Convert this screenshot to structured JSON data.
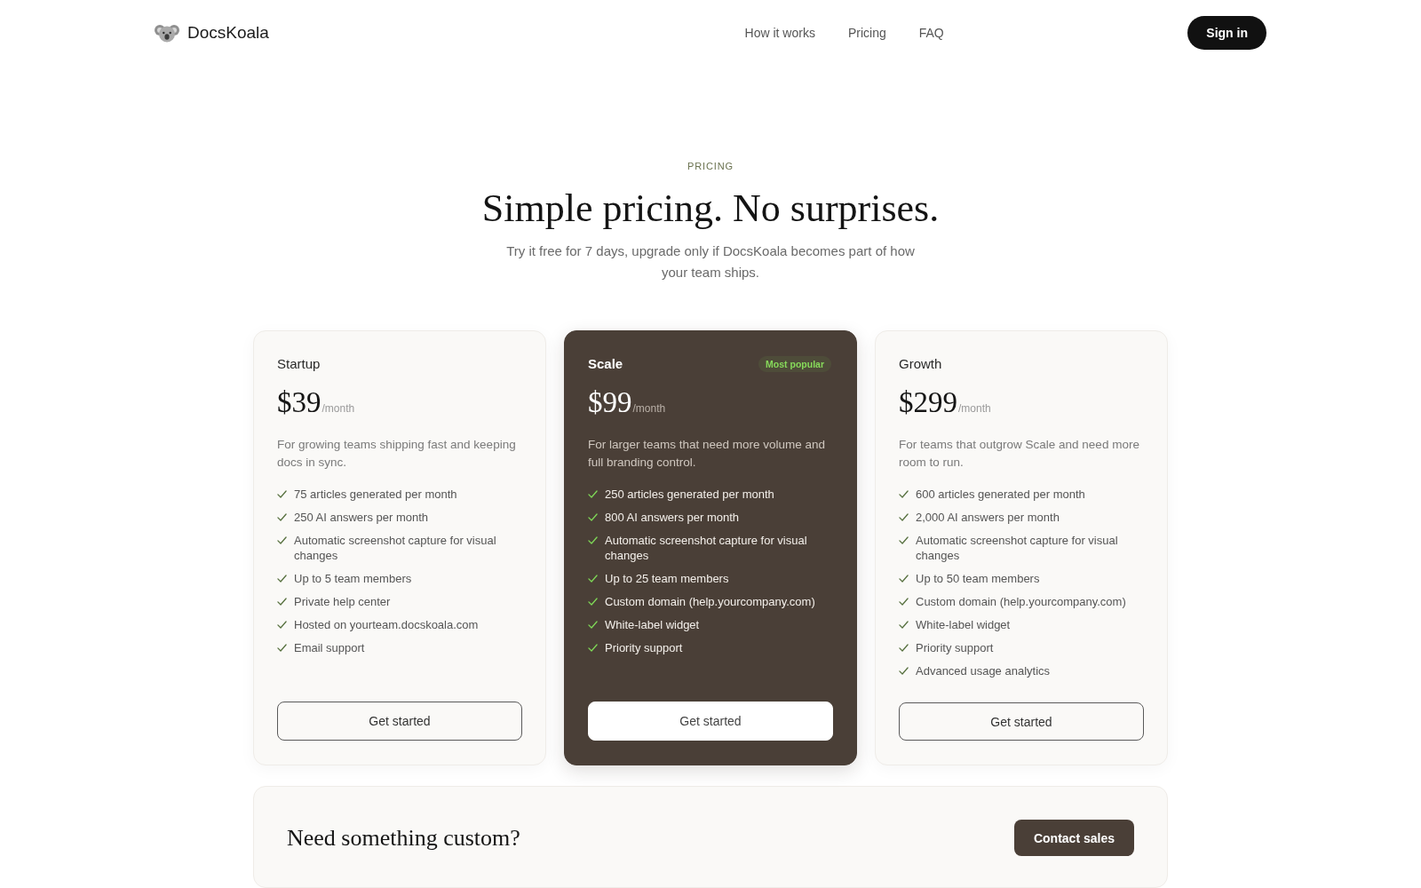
{
  "header": {
    "brand": "DocsKoala",
    "nav": [
      "How it works",
      "Pricing",
      "FAQ"
    ],
    "sign_in": "Sign in"
  },
  "hero": {
    "eyebrow": "PRICING",
    "title": "Simple pricing. No surprises.",
    "subtitle": "Try it free for 7 days, upgrade only if DocsKoala becomes part of how your team ships."
  },
  "plans": [
    {
      "name": "Startup",
      "featured": false,
      "price": "$39",
      "period": "/month",
      "description": "For growing teams shipping fast and keeping docs in sync.",
      "features": [
        "75 articles generated per month",
        "250 AI answers per month",
        "Automatic screenshot capture for visual changes",
        "Up to 5 team members",
        "Private help center",
        "Hosted on yourteam.docskoala.com",
        "Email support"
      ],
      "button": "Get started"
    },
    {
      "name": "Scale",
      "featured": true,
      "badge": "Most popular",
      "price": "$99",
      "period": "/month",
      "description": "For larger teams that need more volume and full branding control.",
      "features": [
        "250 articles generated per month",
        "800 AI answers per month",
        "Automatic screenshot capture for visual changes",
        "Up to 25 team members",
        "Custom domain (help.yourcompany.com)",
        "White-label widget",
        "Priority support"
      ],
      "button": "Get started"
    },
    {
      "name": "Growth",
      "featured": false,
      "price": "$299",
      "period": "/month",
      "description": "For teams that outgrow Scale and need more room to run.",
      "features": [
        "600 articles generated per month",
        "2,000 AI answers per month",
        "Automatic screenshot capture for visual changes",
        "Up to 50 team members",
        "Custom domain (help.yourcompany.com)",
        "White-label widget",
        "Priority support",
        "Advanced usage analytics"
      ],
      "button": "Get started"
    }
  ],
  "custom": {
    "title": "Need something custom?",
    "button": "Contact sales"
  }
}
